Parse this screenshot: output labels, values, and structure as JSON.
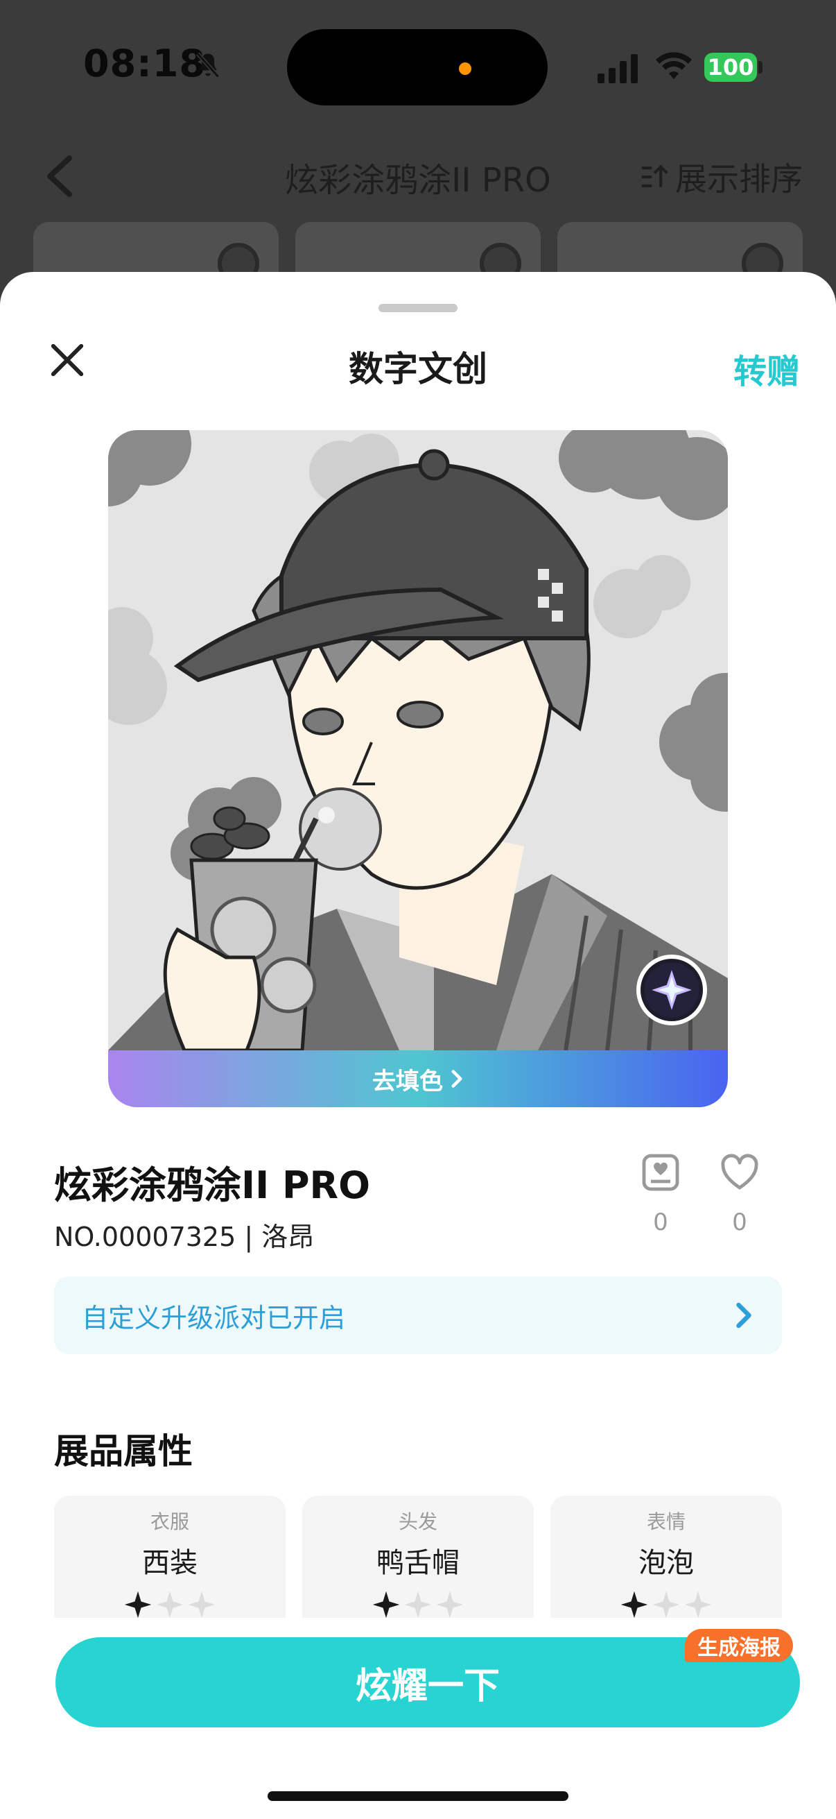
{
  "status_bar": {
    "time": "08:18",
    "battery": "100"
  },
  "background_page": {
    "title": "炫彩涂鸦涂II PRO",
    "sort_label": "展示排序"
  },
  "sheet": {
    "title": "数字文创",
    "gift_label": "转赠",
    "fill_color_label": "去填色",
    "item_title": "炫彩涂鸦涂II PRO",
    "item_no": "NO.00007325 | 洛昂",
    "collect_count": "0",
    "like_count": "0",
    "party_banner": "自定义升级派对已开启",
    "section_title": "展品属性",
    "attributes": [
      {
        "label": "衣服",
        "value": "西装",
        "stars_filled": 1,
        "stars_total": 3
      },
      {
        "label": "头发",
        "value": "鸭舌帽",
        "stars_filled": 1,
        "stars_total": 3
      },
      {
        "label": "表情",
        "value": "泡泡",
        "stars_filled": 1,
        "stars_total": 3
      }
    ],
    "cta_label": "炫耀一下",
    "poster_tag": "生成海报"
  },
  "colors": {
    "accent": "#27d4d2",
    "gift": "#25c9cf",
    "poster_tag": "#f7712b",
    "party_text": "#2c9fd8"
  },
  "icons": [
    "bell-slash-icon",
    "signal-icon",
    "wifi-icon",
    "back-icon",
    "sort-icon",
    "close-icon",
    "chevron-right-icon",
    "collect-icon",
    "heart-icon",
    "star-icon"
  ]
}
